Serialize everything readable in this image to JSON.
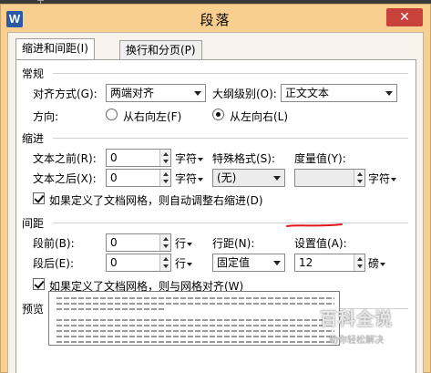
{
  "window": {
    "title": "段落",
    "app_icon": "W",
    "close_label": "✕"
  },
  "tabs": [
    {
      "label": "缩进和间距(I)",
      "active": true
    },
    {
      "label": "换行和分页(P)",
      "active": false
    }
  ],
  "general": {
    "heading": "常规",
    "alignment_label": "对齐方式(G):",
    "alignment_value": "两端对齐",
    "outline_label": "大纲级别(O):",
    "outline_value": "正文文本",
    "direction_label": "方向:",
    "rtl_label": "从右向左(F)",
    "ltr_label": "从左向右(L)",
    "direction_selected": "ltr"
  },
  "indent": {
    "heading": "缩进",
    "before_text_label": "文本之前(R):",
    "before_text_value": "0",
    "before_text_unit": "字符",
    "after_text_label": "文本之后(X):",
    "after_text_value": "0",
    "after_text_unit": "字符",
    "special_label": "特殊格式(S):",
    "special_value": "(无)",
    "measure_label": "度量值(Y):",
    "measure_value": "",
    "measure_unit": "字符",
    "grid_checkbox_label": "如果定义了文档网格，则自动调整右缩进(D)",
    "grid_checked": true
  },
  "spacing": {
    "heading": "间距",
    "before_label": "段前(B):",
    "before_value": "0",
    "before_unit": "行",
    "after_label": "段后(E):",
    "after_value": "0",
    "after_unit": "行",
    "line_spacing_label": "行距(N):",
    "line_spacing_value": "固定值",
    "setting_label": "设置值(A):",
    "setting_value": "12",
    "setting_unit": "磅",
    "grid_checkbox_label": "如果定义了文档网格，则与网格对齐(W)",
    "grid_checked": true
  },
  "preview": {
    "heading": "预览"
  },
  "watermark": {
    "title": "百科全说",
    "subtitle": "助你轻松解决"
  },
  "colors": {
    "title_bar": "#f9cf8f",
    "close_button": "#c8413a",
    "annotation": "#e0191b"
  }
}
